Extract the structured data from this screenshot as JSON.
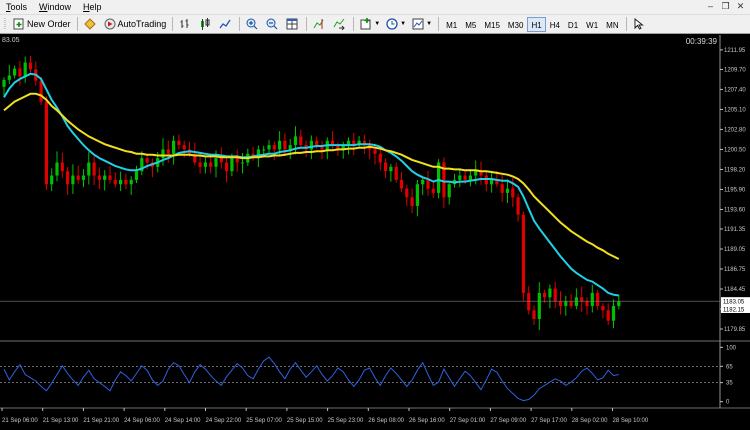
{
  "menu": {
    "items": [
      "Tools",
      "Window",
      "Help"
    ]
  },
  "toolbar": {
    "new_order_label": "New Order",
    "autotrading_label": "AutoTrading",
    "timeframes": [
      "M1",
      "M5",
      "M15",
      "M30",
      "H1",
      "H4",
      "D1",
      "W1",
      "MN"
    ]
  },
  "chart": {
    "clock": "00:39:39",
    "corner_price": "83.05",
    "current_price_label": "1183.05",
    "current_price_line_label": "1182.15",
    "colors": {
      "bull": "#00c000",
      "bear": "#e00000",
      "fast_ma": "#20d0e8",
      "slow_ma": "#f0e020",
      "rsi": "#3060e0",
      "ask_line": "#808080",
      "grid": "#606060"
    }
  },
  "chart_data": [
    {
      "type": "candlestick",
      "y_ticks": [
        1211.95,
        1209.7,
        1207.4,
        1205.1,
        1202.8,
        1200.5,
        1198.2,
        1195.9,
        1193.6,
        1191.35,
        1189.05,
        1186.75,
        1184.45,
        1182.15,
        1179.85
      ],
      "ylim": [
        1178.7,
        1213.2
      ],
      "x_labels": [
        "21 Sep 06:00",
        "21 Sep 13:00",
        "21 Sep 21:00",
        "24 Sep 06:00",
        "24 Sep 14:00",
        "24 Sep 22:00",
        "25 Sep 07:00",
        "25 Sep 15:00",
        "25 Sep 23:00",
        "26 Sep 08:00",
        "26 Sep 16:00",
        "27 Sep 01:00",
        "27 Sep 09:00",
        "27 Sep 17:00",
        "28 Sep 02:00",
        "28 Sep 10:00"
      ],
      "close": [
        1208.5,
        1209.0,
        1209.8,
        1208.9,
        1210.5,
        1209.7,
        1208.4,
        1206.0,
        1196.5,
        1197.5,
        1199.0,
        1198.0,
        1196.5,
        1197.5,
        1197.0,
        1197.5,
        1199.0,
        1197.5,
        1197.0,
        1197.5,
        1197.0,
        1196.5,
        1197.0,
        1196.5,
        1197.0,
        1198.0,
        1199.5,
        1199.0,
        1198.5,
        1199.5,
        1200.5,
        1200.0,
        1201.5,
        1201.0,
        1200.5,
        1200.0,
        1199.0,
        1198.5,
        1199.0,
        1198.5,
        1199.5,
        1199.0,
        1198.0,
        1199.5,
        1199.0,
        1199.0,
        1200.0,
        1199.5,
        1200.5,
        1200.5,
        1201.0,
        1200.5,
        1201.5,
        1200.5,
        1201.0,
        1202.0,
        1201.0,
        1200.5,
        1201.5,
        1201.0,
        1200.5,
        1201.5,
        1201.0,
        1200.5,
        1201.0,
        1201.5,
        1201.0,
        1201.5,
        1201.0,
        1200.5,
        1200.0,
        1199.0,
        1198.0,
        1198.5,
        1197.0,
        1196.0,
        1195.0,
        1194.0,
        1196.5,
        1197.0,
        1196.0,
        1195.5,
        1199.0,
        1195.0,
        1196.5,
        1197.0,
        1197.5,
        1197.0,
        1197.5,
        1198.0,
        1197.5,
        1196.5,
        1197.0,
        1196.5,
        1195.5,
        1196.0,
        1195.0,
        1193.0,
        1184.0,
        1182.0,
        1181.0,
        1184.0,
        1183.5,
        1184.5,
        1183.0,
        1182.5,
        1183.0,
        1182.5,
        1183.5,
        1183.0,
        1182.5,
        1184.0,
        1182.5,
        1182.0,
        1180.8,
        1182.5,
        1183.0
      ],
      "series": [
        {
          "values": [
            1206.5,
            1207.5,
            1208.2,
            1208.6,
            1208.9,
            1209.2,
            1209.1,
            1208.6,
            1207.4,
            1206.2,
            1205.3,
            1204.3,
            1203.2,
            1202.4,
            1201.7,
            1201.0,
            1200.4,
            1199.9,
            1199.5,
            1199.2,
            1198.9,
            1198.6,
            1198.4,
            1198.2,
            1198.1,
            1198.1,
            1198.3,
            1198.6,
            1198.8,
            1199.0,
            1199.3,
            1199.5,
            1199.8,
            1200.1,
            1200.2,
            1200.3,
            1200.2,
            1200.1,
            1200.0,
            1199.9,
            1199.9,
            1199.8,
            1199.7,
            1199.7,
            1199.7,
            1199.6,
            1199.6,
            1199.7,
            1199.8,
            1199.9,
            1200.0,
            1200.0,
            1200.2,
            1200.3,
            1200.4,
            1200.6,
            1200.7,
            1200.7,
            1200.8,
            1200.9,
            1200.9,
            1201.0,
            1201.0,
            1201.0,
            1201.0,
            1201.0,
            1201.0,
            1201.1,
            1201.1,
            1201.1,
            1201.0,
            1200.8,
            1200.4,
            1200.1,
            1199.7,
            1199.2,
            1198.6,
            1198.0,
            1197.6,
            1197.3,
            1197.1,
            1196.8,
            1197.0,
            1196.8,
            1196.8,
            1196.7,
            1196.8,
            1196.8,
            1196.9,
            1197.0,
            1197.1,
            1197.1,
            1197.1,
            1197.0,
            1196.9,
            1196.9,
            1196.6,
            1196.2,
            1195.1,
            1193.7,
            1192.3,
            1191.4,
            1190.6,
            1189.8,
            1189.0,
            1188.2,
            1187.5,
            1186.8,
            1186.3,
            1185.9,
            1185.5,
            1185.3,
            1184.9,
            1184.5,
            1184.0,
            1183.8,
            1183.7
          ]
        },
        {
          "values": [
            1205.0,
            1205.5,
            1206.0,
            1206.3,
            1206.6,
            1206.9,
            1206.9,
            1206.7,
            1206.2,
            1205.5,
            1205.0,
            1204.4,
            1203.8,
            1203.3,
            1202.8,
            1202.4,
            1202.0,
            1201.7,
            1201.4,
            1201.1,
            1200.9,
            1200.7,
            1200.5,
            1200.3,
            1200.2,
            1200.0,
            1200.0,
            1199.9,
            1199.9,
            1199.8,
            1199.8,
            1199.8,
            1199.8,
            1199.9,
            1199.9,
            1199.9,
            1199.8,
            1199.8,
            1199.7,
            1199.7,
            1199.7,
            1199.6,
            1199.6,
            1199.6,
            1199.6,
            1199.5,
            1199.5,
            1199.6,
            1199.6,
            1199.7,
            1199.7,
            1199.8,
            1199.8,
            1199.9,
            1200.0,
            1200.1,
            1200.1,
            1200.2,
            1200.2,
            1200.3,
            1200.3,
            1200.4,
            1200.4,
            1200.5,
            1200.5,
            1200.6,
            1200.6,
            1200.7,
            1200.7,
            1200.8,
            1200.7,
            1200.6,
            1200.4,
            1200.3,
            1200.1,
            1199.9,
            1199.6,
            1199.3,
            1199.1,
            1198.9,
            1198.7,
            1198.5,
            1198.5,
            1198.3,
            1198.3,
            1198.2,
            1198.2,
            1198.1,
            1198.1,
            1198.1,
            1198.0,
            1198.0,
            1197.9,
            1197.8,
            1197.7,
            1197.6,
            1197.4,
            1197.1,
            1196.6,
            1195.9,
            1195.1,
            1194.5,
            1193.9,
            1193.3,
            1192.7,
            1192.1,
            1191.6,
            1191.1,
            1190.7,
            1190.3,
            1189.9,
            1189.6,
            1189.2,
            1188.9,
            1188.5,
            1188.2,
            1187.9
          ]
        }
      ]
    },
    {
      "type": "line",
      "y_ticks": [
        100,
        65,
        35,
        0
      ],
      "ylim": [
        -8,
        108
      ],
      "series": [
        {
          "values": [
            60,
            40,
            55,
            68,
            50,
            44,
            38,
            28,
            20,
            34,
            50,
            66,
            52,
            40,
            30,
            45,
            58,
            42,
            35,
            28,
            20,
            40,
            55,
            48,
            38,
            52,
            66,
            58,
            40,
            30,
            38,
            60,
            72,
            66,
            50,
            35,
            55,
            68,
            60,
            48,
            38,
            30,
            46,
            58,
            70,
            62,
            48,
            42,
            60,
            75,
            82,
            70,
            55,
            42,
            60,
            72,
            58,
            45,
            55,
            66,
            50,
            38,
            48,
            62,
            55,
            40,
            28,
            40,
            58,
            62,
            44,
            30,
            48,
            62,
            52,
            40,
            28,
            40,
            58,
            72,
            50,
            30,
            36,
            60,
            44,
            28,
            42,
            56,
            48,
            35,
            22,
            40,
            60,
            54,
            38,
            24,
            15,
            6,
            2,
            4,
            12,
            24,
            30,
            36,
            42,
            38,
            30,
            36,
            44,
            56,
            62,
            52,
            40,
            44,
            58,
            48,
            50
          ]
        }
      ]
    }
  ]
}
